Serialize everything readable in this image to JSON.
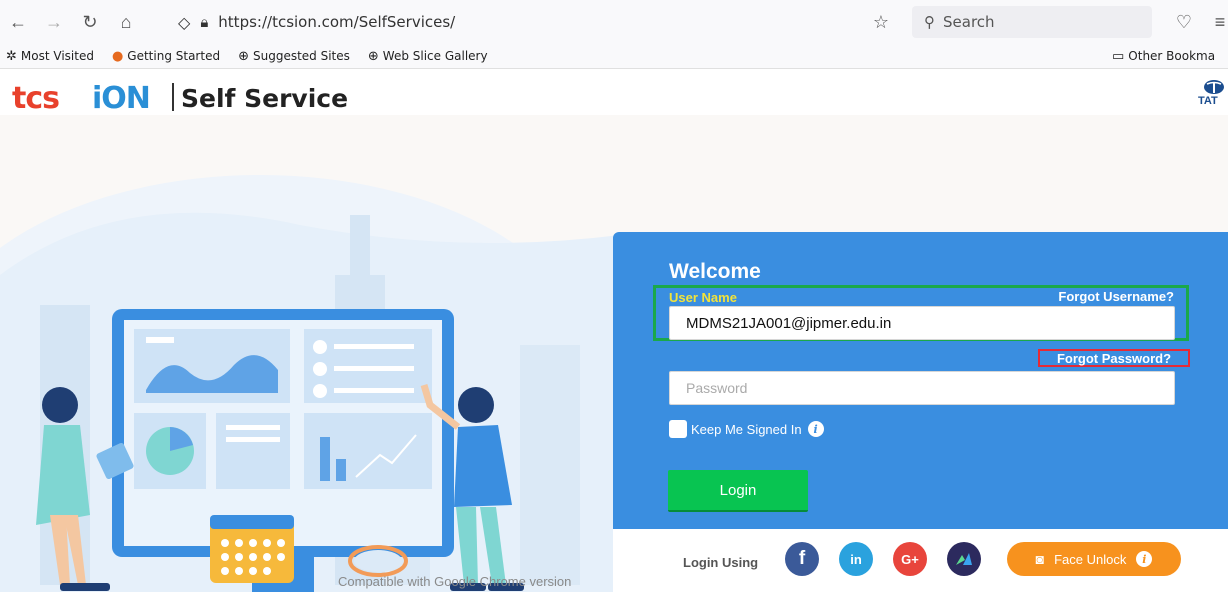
{
  "browser": {
    "url": "https://tcsion.com/SelfServices/",
    "search_placeholder": "Search",
    "bookmarks": [
      "Most Visited",
      "Getting Started",
      "Suggested Sites",
      "Web Slice Gallery"
    ],
    "other_bookmarks": "Other Bookma"
  },
  "header": {
    "logo_tcs": "tcs",
    "logo_ion": "iON",
    "title": "Self Service",
    "brand_right": "TAT"
  },
  "login": {
    "welcome": "Welcome",
    "username_label": "User Name",
    "forgot_username": "Forgot Username?",
    "username_value": "MDMS21JA001@jipmer.edu.in",
    "forgot_password": "Forgot Password?",
    "password_placeholder": "Password",
    "keep_signed_in": "Keep Me Signed In",
    "login_button": "Login",
    "login_using": "Login Using",
    "face_unlock": "Face Unlock"
  },
  "social": {
    "facebook": "f",
    "linkedin": "in",
    "google": "G+"
  },
  "footer_note": "Compatible with Google Chrome version",
  "colors": {
    "panel": "#3a8ee0",
    "login_button": "#08c451",
    "label_yellow": "#f2e33a",
    "highlight_green": "#1aa84b",
    "highlight_red": "#e52a36",
    "face_unlock": "#f7921e"
  }
}
